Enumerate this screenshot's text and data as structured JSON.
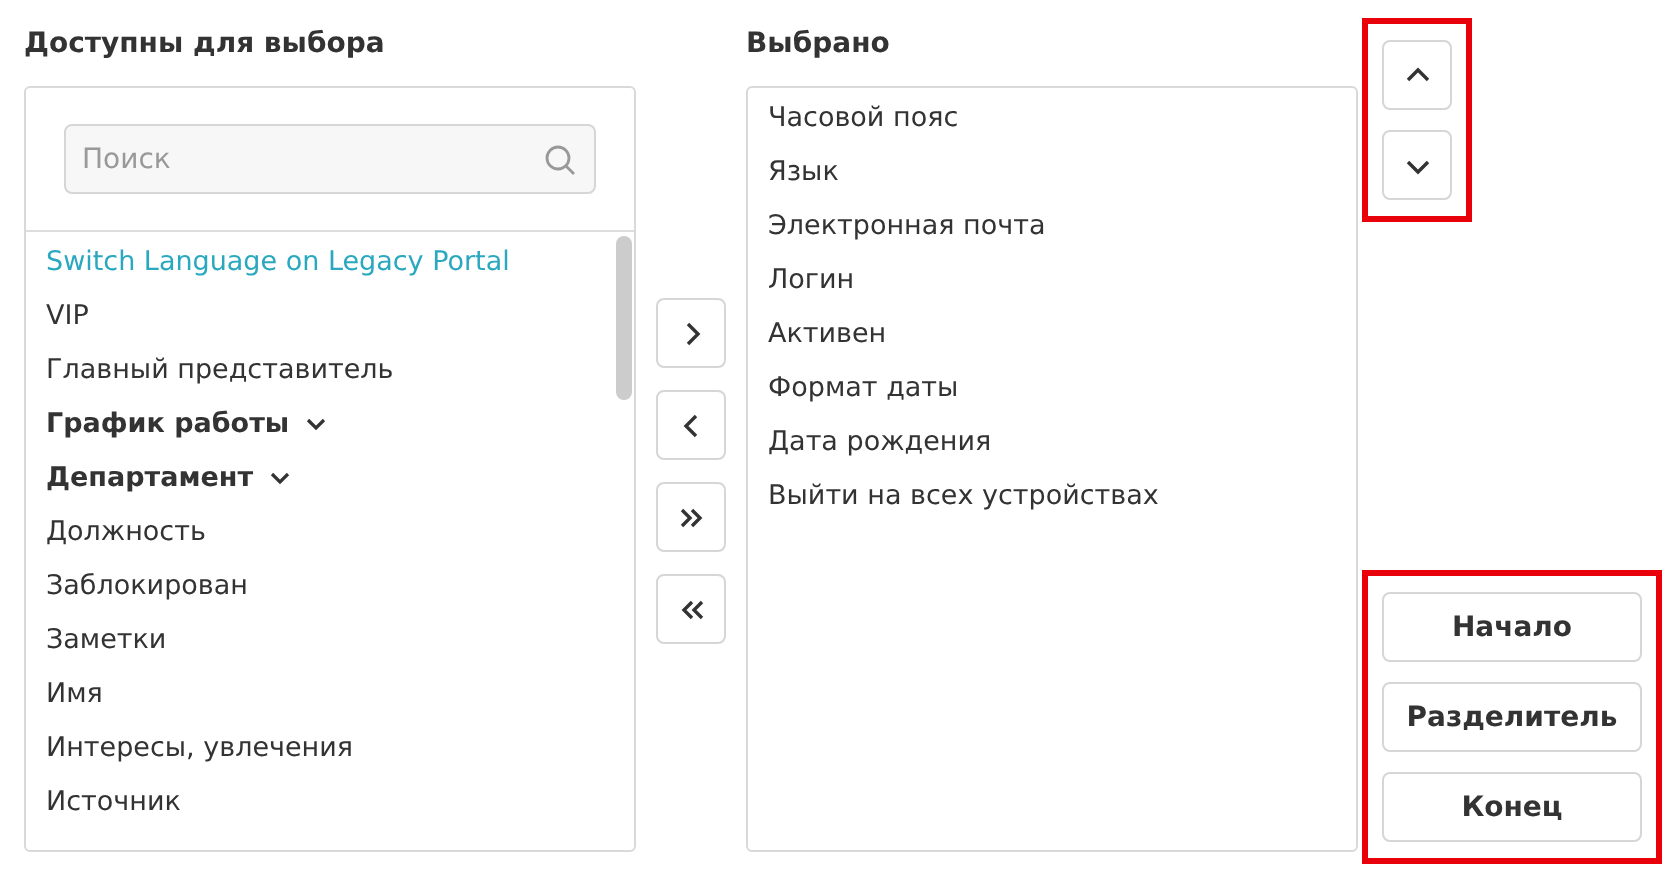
{
  "available": {
    "title": "Доступны для выбора",
    "search": {
      "placeholder": "Поиск"
    },
    "items": [
      {
        "label": "Switch Language on Legacy Portal",
        "kind": "item",
        "selected": true
      },
      {
        "label": "VIP",
        "kind": "item",
        "selected": false
      },
      {
        "label": "Главный представитель",
        "kind": "item",
        "selected": false
      },
      {
        "label": "График работы",
        "kind": "group",
        "selected": false,
        "expanded": false
      },
      {
        "label": "Департамент",
        "kind": "group",
        "selected": false,
        "expanded": false
      },
      {
        "label": "Должность",
        "kind": "item",
        "selected": false
      },
      {
        "label": "Заблокирован",
        "kind": "item",
        "selected": false
      },
      {
        "label": "Заметки",
        "kind": "item",
        "selected": false
      },
      {
        "label": "Имя",
        "kind": "item",
        "selected": false
      },
      {
        "label": "Интересы, увлечения",
        "kind": "item",
        "selected": false
      },
      {
        "label": "Источник",
        "kind": "item",
        "selected": false
      }
    ]
  },
  "transfer_buttons": [
    {
      "kind": "add"
    },
    {
      "kind": "remove"
    },
    {
      "kind": "add_all"
    },
    {
      "kind": "remove_all"
    }
  ],
  "chosen": {
    "title": "Выбрано",
    "items": [
      {
        "label": "Часовой пояс",
        "selected": false
      },
      {
        "label": "Язык",
        "selected": false
      },
      {
        "label": "Электронная почта",
        "selected": false
      },
      {
        "label": "Логин",
        "selected": false
      },
      {
        "label": "Активен",
        "selected": false
      },
      {
        "label": "Формат даты",
        "selected": false
      },
      {
        "label": "Дата рождения",
        "selected": false
      },
      {
        "label": "Выйти на всех устройствах",
        "selected": false
      }
    ]
  },
  "order_buttons": {
    "highlighted": true,
    "items": [
      {
        "kind": "up"
      },
      {
        "kind": "down"
      }
    ]
  },
  "position_buttons": {
    "highlighted": true,
    "items": [
      {
        "label": "Начало"
      },
      {
        "label": "Разделитель"
      },
      {
        "label": "Конец"
      }
    ]
  }
}
